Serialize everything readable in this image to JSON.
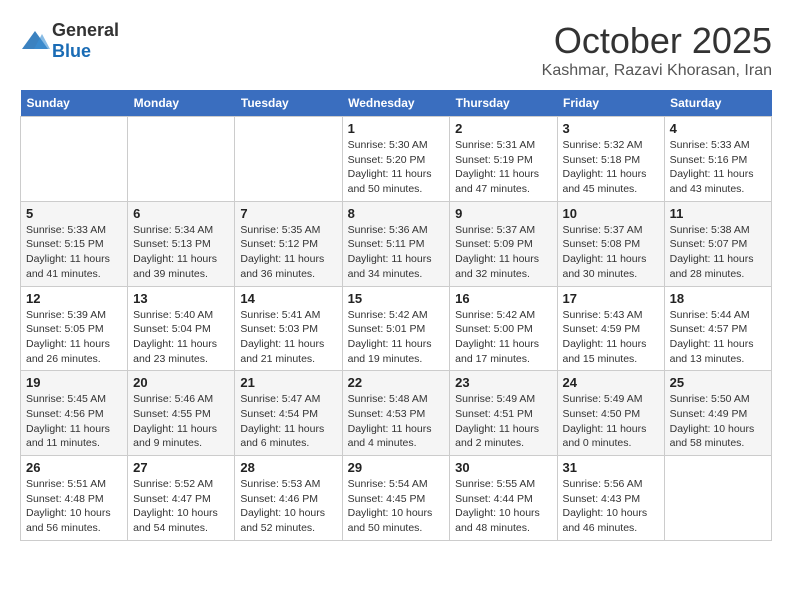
{
  "header": {
    "logo_general": "General",
    "logo_blue": "Blue",
    "month": "October 2025",
    "location": "Kashmar, Razavi Khorasan, Iran"
  },
  "days_of_week": [
    "Sunday",
    "Monday",
    "Tuesday",
    "Wednesday",
    "Thursday",
    "Friday",
    "Saturday"
  ],
  "weeks": [
    [
      {
        "day": "",
        "info": ""
      },
      {
        "day": "",
        "info": ""
      },
      {
        "day": "",
        "info": ""
      },
      {
        "day": "1",
        "info": "Sunrise: 5:30 AM\nSunset: 5:20 PM\nDaylight: 11 hours\nand 50 minutes."
      },
      {
        "day": "2",
        "info": "Sunrise: 5:31 AM\nSunset: 5:19 PM\nDaylight: 11 hours\nand 47 minutes."
      },
      {
        "day": "3",
        "info": "Sunrise: 5:32 AM\nSunset: 5:18 PM\nDaylight: 11 hours\nand 45 minutes."
      },
      {
        "day": "4",
        "info": "Sunrise: 5:33 AM\nSunset: 5:16 PM\nDaylight: 11 hours\nand 43 minutes."
      }
    ],
    [
      {
        "day": "5",
        "info": "Sunrise: 5:33 AM\nSunset: 5:15 PM\nDaylight: 11 hours\nand 41 minutes."
      },
      {
        "day": "6",
        "info": "Sunrise: 5:34 AM\nSunset: 5:13 PM\nDaylight: 11 hours\nand 39 minutes."
      },
      {
        "day": "7",
        "info": "Sunrise: 5:35 AM\nSunset: 5:12 PM\nDaylight: 11 hours\nand 36 minutes."
      },
      {
        "day": "8",
        "info": "Sunrise: 5:36 AM\nSunset: 5:11 PM\nDaylight: 11 hours\nand 34 minutes."
      },
      {
        "day": "9",
        "info": "Sunrise: 5:37 AM\nSunset: 5:09 PM\nDaylight: 11 hours\nand 32 minutes."
      },
      {
        "day": "10",
        "info": "Sunrise: 5:37 AM\nSunset: 5:08 PM\nDaylight: 11 hours\nand 30 minutes."
      },
      {
        "day": "11",
        "info": "Sunrise: 5:38 AM\nSunset: 5:07 PM\nDaylight: 11 hours\nand 28 minutes."
      }
    ],
    [
      {
        "day": "12",
        "info": "Sunrise: 5:39 AM\nSunset: 5:05 PM\nDaylight: 11 hours\nand 26 minutes."
      },
      {
        "day": "13",
        "info": "Sunrise: 5:40 AM\nSunset: 5:04 PM\nDaylight: 11 hours\nand 23 minutes."
      },
      {
        "day": "14",
        "info": "Sunrise: 5:41 AM\nSunset: 5:03 PM\nDaylight: 11 hours\nand 21 minutes."
      },
      {
        "day": "15",
        "info": "Sunrise: 5:42 AM\nSunset: 5:01 PM\nDaylight: 11 hours\nand 19 minutes."
      },
      {
        "day": "16",
        "info": "Sunrise: 5:42 AM\nSunset: 5:00 PM\nDaylight: 11 hours\nand 17 minutes."
      },
      {
        "day": "17",
        "info": "Sunrise: 5:43 AM\nSunset: 4:59 PM\nDaylight: 11 hours\nand 15 minutes."
      },
      {
        "day": "18",
        "info": "Sunrise: 5:44 AM\nSunset: 4:57 PM\nDaylight: 11 hours\nand 13 minutes."
      }
    ],
    [
      {
        "day": "19",
        "info": "Sunrise: 5:45 AM\nSunset: 4:56 PM\nDaylight: 11 hours\nand 11 minutes."
      },
      {
        "day": "20",
        "info": "Sunrise: 5:46 AM\nSunset: 4:55 PM\nDaylight: 11 hours\nand 9 minutes."
      },
      {
        "day": "21",
        "info": "Sunrise: 5:47 AM\nSunset: 4:54 PM\nDaylight: 11 hours\nand 6 minutes."
      },
      {
        "day": "22",
        "info": "Sunrise: 5:48 AM\nSunset: 4:53 PM\nDaylight: 11 hours\nand 4 minutes."
      },
      {
        "day": "23",
        "info": "Sunrise: 5:49 AM\nSunset: 4:51 PM\nDaylight: 11 hours\nand 2 minutes."
      },
      {
        "day": "24",
        "info": "Sunrise: 5:49 AM\nSunset: 4:50 PM\nDaylight: 11 hours\nand 0 minutes."
      },
      {
        "day": "25",
        "info": "Sunrise: 5:50 AM\nSunset: 4:49 PM\nDaylight: 10 hours\nand 58 minutes."
      }
    ],
    [
      {
        "day": "26",
        "info": "Sunrise: 5:51 AM\nSunset: 4:48 PM\nDaylight: 10 hours\nand 56 minutes."
      },
      {
        "day": "27",
        "info": "Sunrise: 5:52 AM\nSunset: 4:47 PM\nDaylight: 10 hours\nand 54 minutes."
      },
      {
        "day": "28",
        "info": "Sunrise: 5:53 AM\nSunset: 4:46 PM\nDaylight: 10 hours\nand 52 minutes."
      },
      {
        "day": "29",
        "info": "Sunrise: 5:54 AM\nSunset: 4:45 PM\nDaylight: 10 hours\nand 50 minutes."
      },
      {
        "day": "30",
        "info": "Sunrise: 5:55 AM\nSunset: 4:44 PM\nDaylight: 10 hours\nand 48 minutes."
      },
      {
        "day": "31",
        "info": "Sunrise: 5:56 AM\nSunset: 4:43 PM\nDaylight: 10 hours\nand 46 minutes."
      },
      {
        "day": "",
        "info": ""
      }
    ]
  ]
}
